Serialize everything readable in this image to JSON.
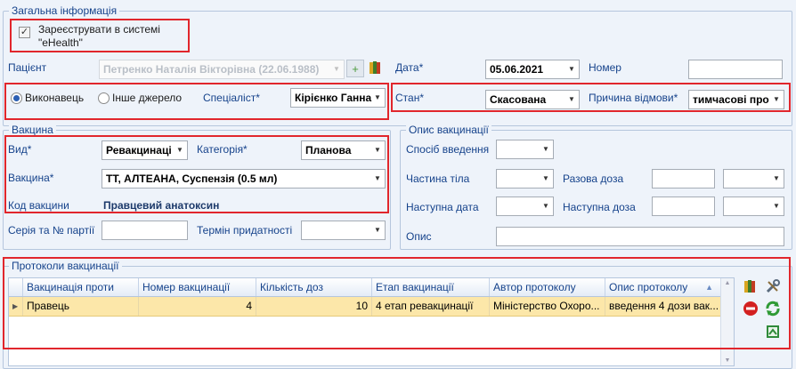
{
  "general": {
    "legend": "Загальна інформація",
    "register_label": "Зареєструвати в системі \"eHealth\"",
    "register_checked": true,
    "patient_label": "Пацієнт",
    "patient_value": "Петренко Наталія Вікторівна (22.06.1988)",
    "date_label": "Дата*",
    "date_value": "05.06.2021",
    "number_label": "Номер",
    "number_value": "",
    "performer_label": "Виконавець",
    "other_source_label": "Інше джерело",
    "performer_selected": "Виконавець",
    "specialist_label": "Спеціаліст*",
    "specialist_value": "Кірієнко Ганна",
    "status_label": "Стан*",
    "status_value": "Скасована",
    "reject_reason_label": "Причина відмови*",
    "reject_reason_value": "тимчасові про"
  },
  "vaccine": {
    "legend": "Вакцина",
    "type_label": "Вид*",
    "type_value": "Ревакцинаці",
    "category_label": "Категорія*",
    "category_value": "Планова",
    "vaccine_label": "Вакцина*",
    "vaccine_value": "ТТ, АЛТЕАНА, Суспензія (0.5 мл)",
    "code_label": "Код вакцини",
    "code_value": "Правцевий анатоксин",
    "batch_label": "Серія та № партії",
    "batch_value": "",
    "expiry_label": "Термін придатності",
    "expiry_value": ""
  },
  "description": {
    "legend": "Опис вакцинації",
    "method_label": "Спосіб введення",
    "body_part_label": "Частина тіла",
    "single_dose_label": "Разова доза",
    "next_date_label": "Наступна дата",
    "next_dose_label": "Наступна доза",
    "desc_label": "Опис"
  },
  "protocols": {
    "legend": "Протоколи вакцинації",
    "columns": [
      "Вакцинація проти",
      "Номер вакцинації",
      "Кількість доз",
      "Етап вакцинації",
      "Автор протоколу",
      "Опис протоколу"
    ],
    "rows": [
      [
        "Правець",
        "4",
        "10",
        "4 етап ревакцинації",
        "Міністерство Охоро...",
        "введення 4 дози вак..."
      ]
    ]
  },
  "icons": {
    "book": "book-icon",
    "tools": "tools-icon",
    "delete": "delete-icon",
    "refresh": "refresh-icon",
    "export": "export-icon"
  }
}
